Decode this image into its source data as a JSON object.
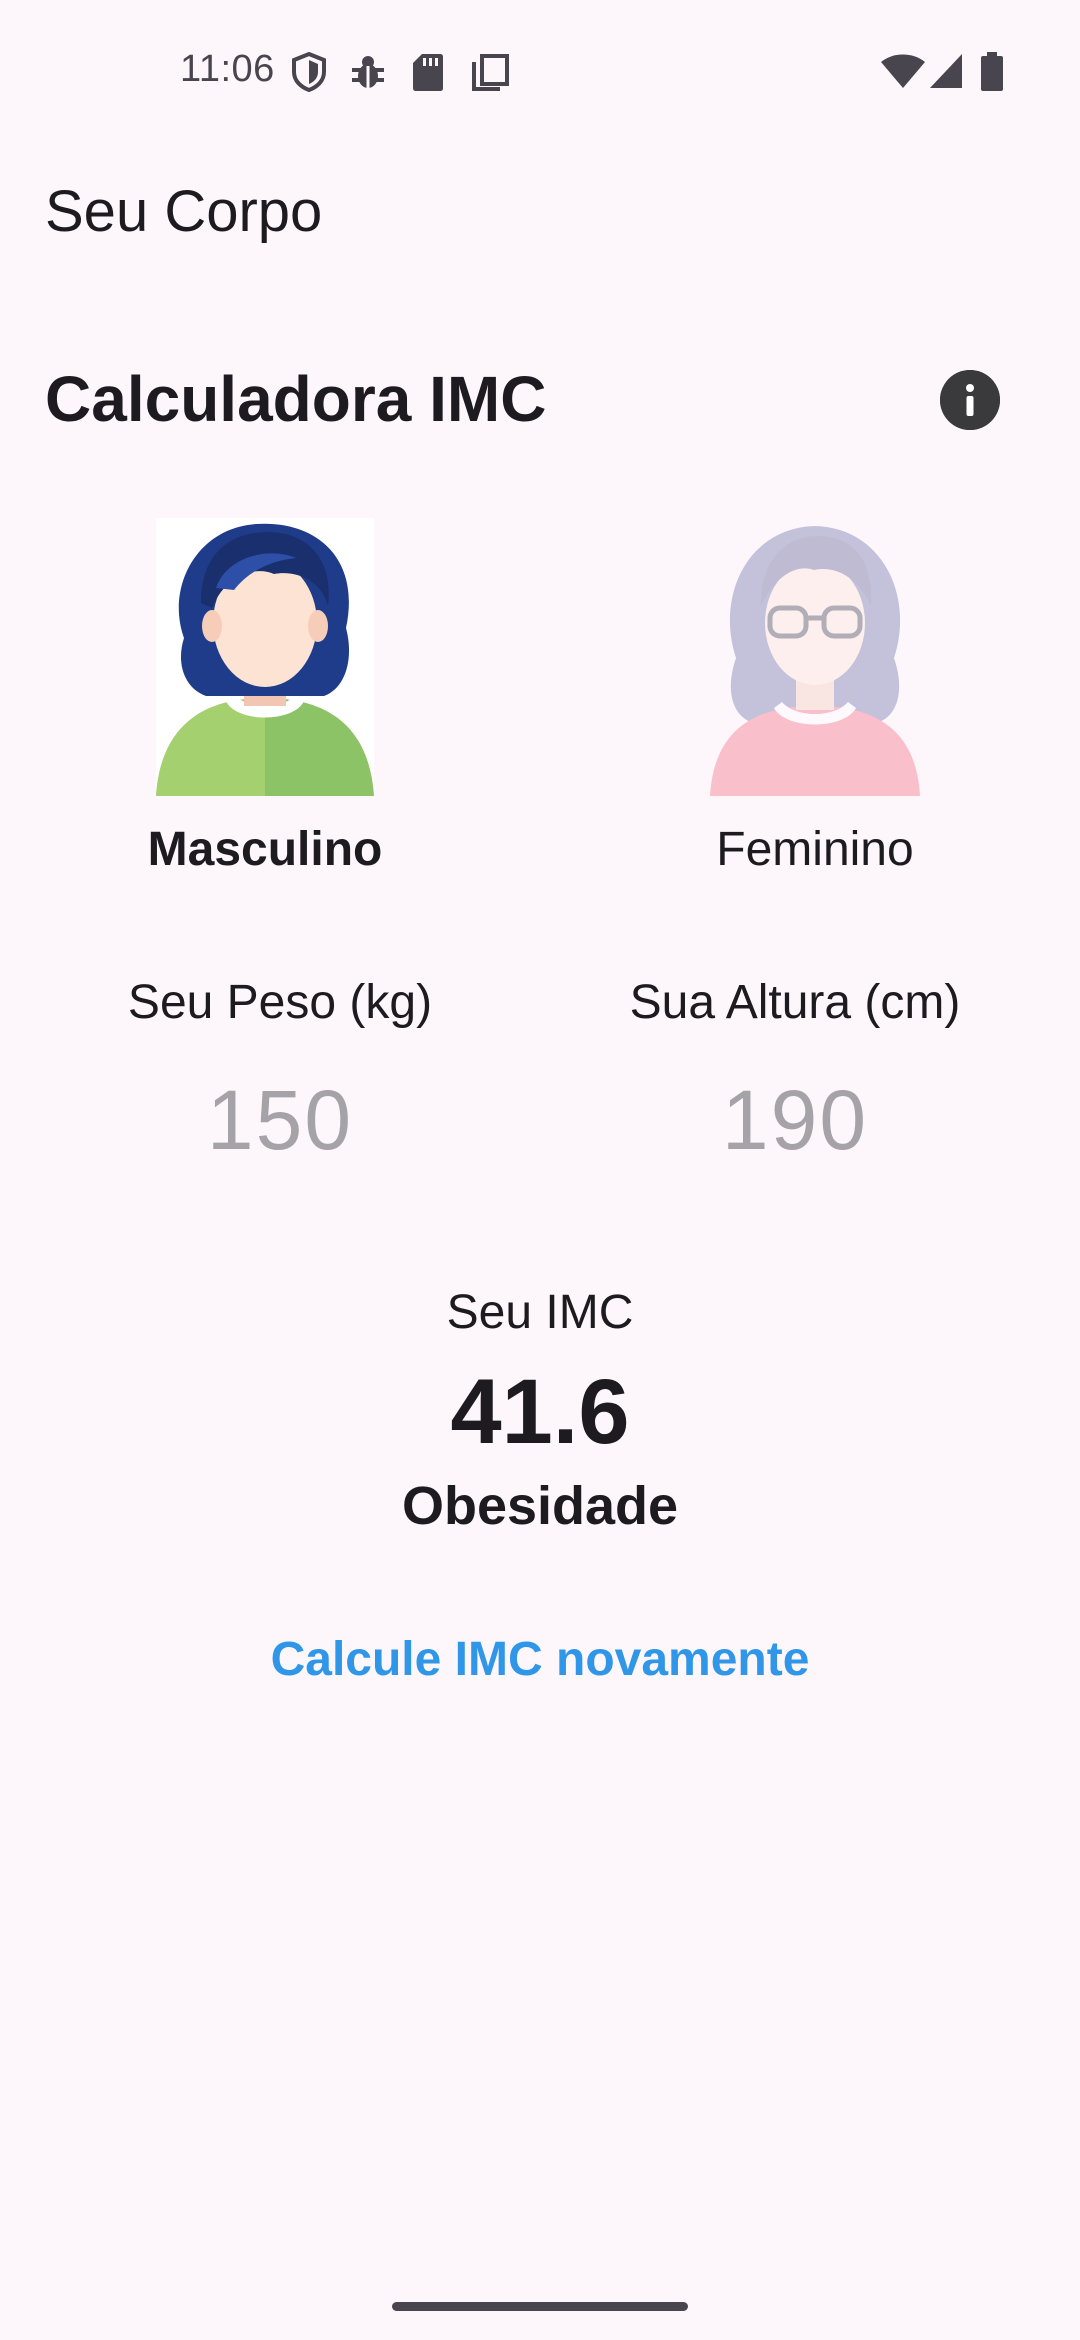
{
  "status_bar": {
    "time": "11:06",
    "icons_left": [
      "shield-icon",
      "bug-icon",
      "sd-card-icon",
      "copy-icon"
    ],
    "icons_right": [
      "wifi-icon",
      "signal-icon",
      "battery-icon"
    ]
  },
  "app_bar": {
    "title": "Seu Corpo"
  },
  "calculator": {
    "heading": "Calculadora IMC",
    "info_icon": "info-icon"
  },
  "gender": {
    "selected": "male",
    "male_label": "Masculino",
    "female_label": "Feminino"
  },
  "inputs": {
    "weight_label": "Seu Peso (kg)",
    "weight_value": "150",
    "height_label": "Sua Altura (cm)",
    "height_value": "190"
  },
  "result": {
    "label": "Seu IMC",
    "value": "41.6",
    "category": "Obesidade"
  },
  "actions": {
    "recalculate_label": "Calcule IMC novamente"
  },
  "colors": {
    "background": "#fdf7fc",
    "accent": "#2f96e8",
    "value_gray": "#a5a3a8"
  }
}
